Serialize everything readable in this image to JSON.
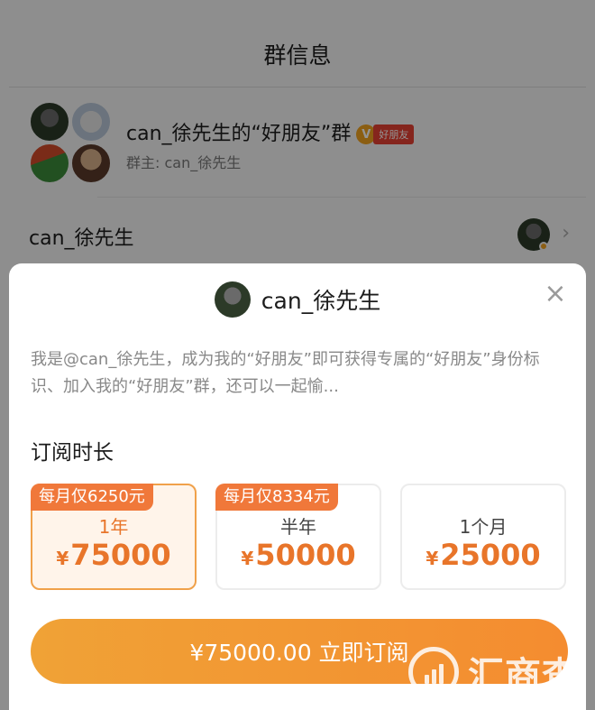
{
  "page": {
    "title": "群信息"
  },
  "group": {
    "name": "can_徐先生的“好朋友”群",
    "badge_label": "好朋友",
    "badge_v": "V",
    "owner_text": "群主: can_徐先生"
  },
  "owner_row": {
    "name": "can_徐先生",
    "chevron": "›"
  },
  "sheet": {
    "name": "can_徐先生",
    "close_symbol": "×",
    "description": "我是@can_徐先生，成为我的“好朋友”即可获得专属的“好朋友”身份标识、加入我的“好朋友”群，还可以一起愉...",
    "duration_title": "订阅时长",
    "plans": [
      {
        "tag": "每月仅6250元",
        "duration": "1年",
        "currency": "¥",
        "price": "75000",
        "selected": true
      },
      {
        "tag": "每月仅8334元",
        "duration": "半年",
        "currency": "¥",
        "price": "50000",
        "selected": false
      },
      {
        "tag": "",
        "duration": "1个月",
        "currency": "¥",
        "price": "25000",
        "selected": false
      }
    ],
    "subscribe_label": "¥75000.00 立即订阅"
  },
  "watermark": {
    "text": "汇商查"
  },
  "colors": {
    "accent": "#e8752a",
    "tag": "#f0783a",
    "button_start": "#f0a236",
    "button_end": "#f48c30",
    "badge_red": "#e54033",
    "badge_gold": "#f0a21f"
  }
}
